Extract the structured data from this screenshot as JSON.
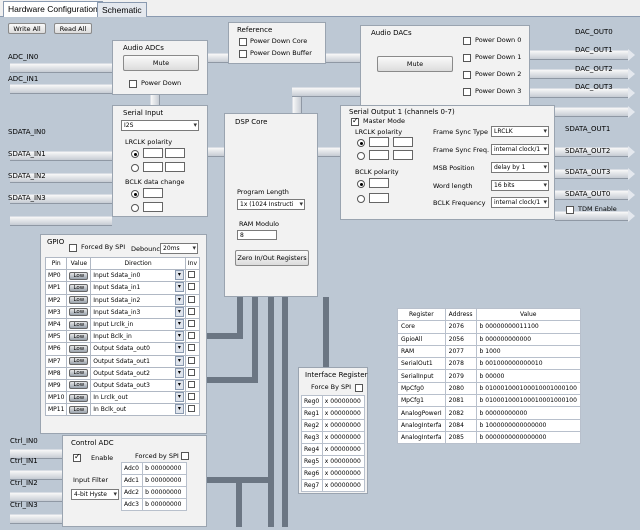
{
  "tabs": [
    "Hardware Configuration",
    "Schematic"
  ],
  "toolbar": {
    "write_all": "Write All",
    "read_all": "Read All"
  },
  "inputs_left": {
    "adc": [
      "ADC_IN0",
      "ADC_IN1"
    ],
    "sdata": [
      "SDATA_IN0",
      "SDATA_IN1",
      "SDATA_IN2",
      "SDATA_IN3"
    ],
    "ctrl": [
      "Ctrl_IN0",
      "Ctrl_IN1",
      "Ctrl_IN2",
      "Ctrl_IN3"
    ]
  },
  "outputs_right": {
    "dac": [
      "DAC_OUT0",
      "DAC_OUT1",
      "DAC_OUT2",
      "DAC_OUT3"
    ],
    "sdata": [
      "SDATA_OUT1",
      "SDATA_OUT2",
      "SDATA_OUT3",
      "SDATA_OUT0"
    ]
  },
  "audio_adcs": {
    "title": "Audio ADCs",
    "mute": "Mute",
    "power_down": "Power Down"
  },
  "reference": {
    "title": "Reference",
    "power_down_core": "Power Down Core",
    "power_down_buffer": "Power Down Buffer"
  },
  "audio_dacs": {
    "title": "Audio DACs",
    "mute": "Mute",
    "power_down": [
      "Power Down 0",
      "Power Down 1",
      "Power Down 2",
      "Power Down 3"
    ]
  },
  "serial_input": {
    "title": "Serial Input",
    "mode": "I2S",
    "lrclk": "LRCLK polarity",
    "bclk": "BCLK data change"
  },
  "dsp_core": {
    "title": "DSP Core",
    "program_length_label": "Program Length",
    "program_length": "1x (1024 Instructi",
    "ram_modulo_label": "RAM Modulo",
    "ram_modulo": "8",
    "zero_btn": "Zero In/Out Registers"
  },
  "serial_output": {
    "title": "Serial Output 1 (channels 0-7)",
    "master_mode": "Master Mode",
    "lrclk": "LRCLK polarity",
    "bclk": "BCLK polarity",
    "fields": [
      {
        "label": "Frame Sync Type",
        "value": "LRCLK"
      },
      {
        "label": "Frame Sync Freq.",
        "value": "internal clock/1"
      },
      {
        "label": "MSB Position",
        "value": "delay by 1"
      },
      {
        "label": "Word length",
        "value": "16 bits"
      },
      {
        "label": "BCLK Frequency",
        "value": "internal clock/1"
      }
    ],
    "tdm_enable": "TDM Enable"
  },
  "gpio": {
    "title": "GPIO",
    "forced_by_spi": "Forced By SPI",
    "debounce_label": "Debounce",
    "debounce": "20ms",
    "headers": [
      "Pin",
      "Value",
      "Direction",
      "Inv"
    ],
    "rows": [
      {
        "pin": "MP0",
        "value": "Low",
        "direction": "Input  Sdata_in0"
      },
      {
        "pin": "MP1",
        "value": "Low",
        "direction": "Input  Sdata_in1"
      },
      {
        "pin": "MP2",
        "value": "Low",
        "direction": "Input  Sdata_in2"
      },
      {
        "pin": "MP3",
        "value": "Low",
        "direction": "Input  Sdata_in3"
      },
      {
        "pin": "MP4",
        "value": "Low",
        "direction": "Input  Lrclk_in"
      },
      {
        "pin": "MP5",
        "value": "Low",
        "direction": "Input  Bclk_in"
      },
      {
        "pin": "MP6",
        "value": "Low",
        "direction": "Output Sdata_out0"
      },
      {
        "pin": "MP7",
        "value": "Low",
        "direction": "Output Sdata_out1"
      },
      {
        "pin": "MP8",
        "value": "Low",
        "direction": "Output Sdata_out2"
      },
      {
        "pin": "MP9",
        "value": "Low",
        "direction": "Output Sdata_out3"
      },
      {
        "pin": "MP10",
        "value": "Low",
        "direction": "In Lrclk_out"
      },
      {
        "pin": "MP11",
        "value": "Low",
        "direction": "In Bclk_out"
      }
    ]
  },
  "interface_register": {
    "title": "Interface Register",
    "forced_by_spi": "Force By SPI",
    "rows": [
      {
        "name": "Reg0",
        "value": "x 00000000"
      },
      {
        "name": "Reg1",
        "value": "x 00000000"
      },
      {
        "name": "Reg2",
        "value": "x 00000000"
      },
      {
        "name": "Reg3",
        "value": "x 00000000"
      },
      {
        "name": "Reg4",
        "value": "x 00000000"
      },
      {
        "name": "Reg5",
        "value": "x 00000000"
      },
      {
        "name": "Reg6",
        "value": "x 00000000"
      },
      {
        "name": "Reg7",
        "value": "x 00000000"
      }
    ]
  },
  "registers": {
    "headers": [
      "Register",
      "Address",
      "Value"
    ],
    "rows": [
      {
        "name": "Core",
        "address": "2076",
        "value": "b 00000000011100"
      },
      {
        "name": "GpioAll",
        "address": "2056",
        "value": "b 000000000000"
      },
      {
        "name": "RAM",
        "address": "2077",
        "value": "b 1000"
      },
      {
        "name": "SerialOut1",
        "address": "2078",
        "value": "b 001000000000010"
      },
      {
        "name": "SerialInput",
        "address": "2079",
        "value": "b 00000"
      },
      {
        "name": "MpCfg0",
        "address": "2080",
        "value": "b 010001000100010001000100"
      },
      {
        "name": "MpCfg1",
        "address": "2081",
        "value": "b 010001000100010001000100"
      },
      {
        "name": "AnalogPowerI",
        "address": "2082",
        "value": "b 00000000000"
      },
      {
        "name": "AnalogInterfa",
        "address": "2084",
        "value": "b 1000000000000000"
      },
      {
        "name": "AnalogInterfa",
        "address": "2085",
        "value": "b 0000000000000000"
      }
    ]
  },
  "control_adc": {
    "title": "Control ADC",
    "enable": "Enable",
    "forced_by_spi": "Forced by SPI",
    "input_filter_label": "Input Filter",
    "input_filter": "4-bit Hyste",
    "rows": [
      {
        "name": "Adc0",
        "value": "b 00000000"
      },
      {
        "name": "Adc1",
        "value": "b 00000000"
      },
      {
        "name": "Adc2",
        "value": "b 00000000"
      },
      {
        "name": "Adc3",
        "value": "b 00000000"
      }
    ]
  }
}
